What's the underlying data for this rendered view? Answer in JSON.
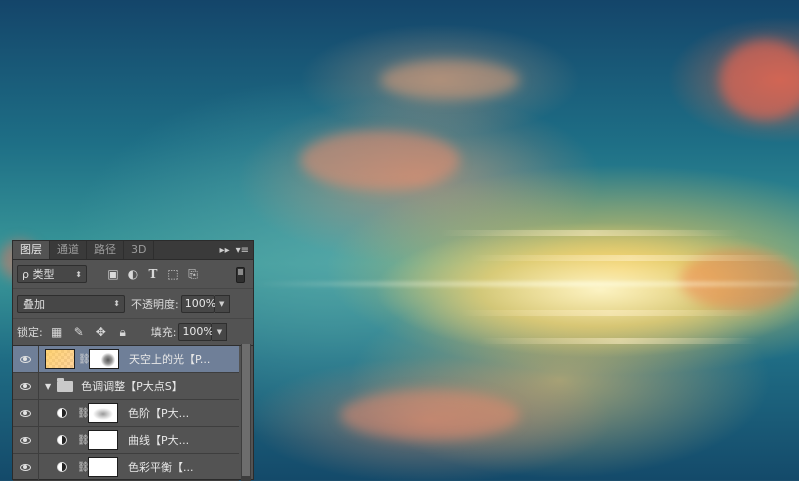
{
  "panel": {
    "tabs": [
      "图层",
      "通道",
      "路径",
      "3D"
    ],
    "active_tab": "图层",
    "collapse_glyph": "▸▸",
    "menu_glyph": "▾≡"
  },
  "filter": {
    "kind_label": "ρ 类型",
    "icons": [
      "image-filter-icon",
      "adjustment-filter-icon",
      "type-filter-icon",
      "shape-filter-icon",
      "smart-object-filter-icon"
    ]
  },
  "blend": {
    "mode": "叠加",
    "opacity_label": "不透明度:",
    "opacity_value": "100%"
  },
  "lock": {
    "label": "锁定:",
    "icons": [
      "lock-transparent-icon",
      "lock-image-icon",
      "lock-position-icon",
      "lock-all-icon"
    ],
    "fill_label": "填充:",
    "fill_value": "100%"
  },
  "layers": [
    {
      "name": "天空上的光【P...",
      "selected": true,
      "type": "pixel-with-mask"
    },
    {
      "name": "色调调整【P大点S】",
      "selected": false,
      "type": "group"
    },
    {
      "name": "色阶【P大...",
      "selected": false,
      "type": "adjustment-levels"
    },
    {
      "name": "曲线【P大...",
      "selected": false,
      "type": "adjustment-curves"
    },
    {
      "name": "色彩平衡【...",
      "selected": false,
      "type": "adjustment-color-balance"
    }
  ]
}
